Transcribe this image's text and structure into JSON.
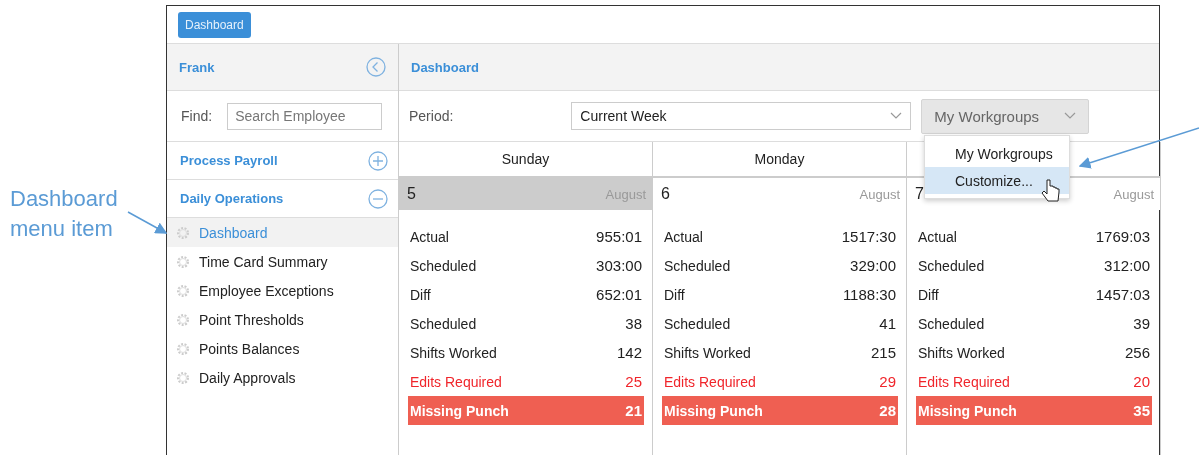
{
  "callout": {
    "text": "Dashboard menu item"
  },
  "top_bar": {
    "button": "Dashboard"
  },
  "sidebar": {
    "user": "Frank",
    "find_label": "Find:",
    "search": {
      "placeholder": "Search Employee"
    },
    "sections": [
      {
        "title": "Process Payroll",
        "expanded": false
      },
      {
        "title": "Daily Operations",
        "expanded": true
      }
    ],
    "items": [
      {
        "label": "Dashboard",
        "selected": true
      },
      {
        "label": "Time Card Summary",
        "selected": false
      },
      {
        "label": "Employee Exceptions",
        "selected": false
      },
      {
        "label": "Point Thresholds",
        "selected": false
      },
      {
        "label": "Points Balances",
        "selected": false
      },
      {
        "label": "Daily Approvals",
        "selected": false
      }
    ]
  },
  "main": {
    "title": "Dashboard",
    "period_label": "Period:",
    "period_value": "Current Week",
    "workgroups_button": "My Workgroups",
    "dropdown": [
      {
        "label": "My Workgroups",
        "selected": false
      },
      {
        "label": "Customize...",
        "selected": true
      }
    ]
  },
  "days": [
    {
      "name": "Sunday",
      "date": "5",
      "month": "August",
      "selected": true,
      "rows": [
        {
          "label": "Actual",
          "value": "955:01",
          "kind": "normal"
        },
        {
          "label": "Scheduled",
          "value": "303:00",
          "kind": "normal"
        },
        {
          "label": "Diff",
          "value": "652:01",
          "kind": "normal"
        },
        {
          "label": "Scheduled",
          "value": "38",
          "kind": "normal"
        },
        {
          "label": "Shifts Worked",
          "value": "142",
          "kind": "normal"
        },
        {
          "label": "Edits Required",
          "value": "25",
          "kind": "warning"
        },
        {
          "label": "Missing Punch",
          "value": "21",
          "kind": "alert"
        }
      ]
    },
    {
      "name": "Monday",
      "date": "6",
      "month": "August",
      "selected": false,
      "rows": [
        {
          "label": "Actual",
          "value": "1517:30",
          "kind": "normal"
        },
        {
          "label": "Scheduled",
          "value": "329:00",
          "kind": "normal"
        },
        {
          "label": "Diff",
          "value": "1188:30",
          "kind": "normal"
        },
        {
          "label": "Scheduled",
          "value": "41",
          "kind": "normal"
        },
        {
          "label": "Shifts Worked",
          "value": "215",
          "kind": "normal"
        },
        {
          "label": "Edits Required",
          "value": "29",
          "kind": "warning"
        },
        {
          "label": "Missing Punch",
          "value": "28",
          "kind": "alert"
        }
      ]
    },
    {
      "date": "7",
      "month": "August",
      "selected": false,
      "rows": [
        {
          "label": "Actual",
          "value": "1769:03",
          "kind": "normal"
        },
        {
          "label": "Scheduled",
          "value": "312:00",
          "kind": "normal"
        },
        {
          "label": "Diff",
          "value": "1457:03",
          "kind": "normal"
        },
        {
          "label": "Scheduled",
          "value": "39",
          "kind": "normal"
        },
        {
          "label": "Shifts Worked",
          "value": "256",
          "kind": "normal"
        },
        {
          "label": "Edits Required",
          "value": "20",
          "kind": "warning"
        },
        {
          "label": "Missing Punch",
          "value": "35",
          "kind": "alert"
        }
      ]
    }
  ]
}
